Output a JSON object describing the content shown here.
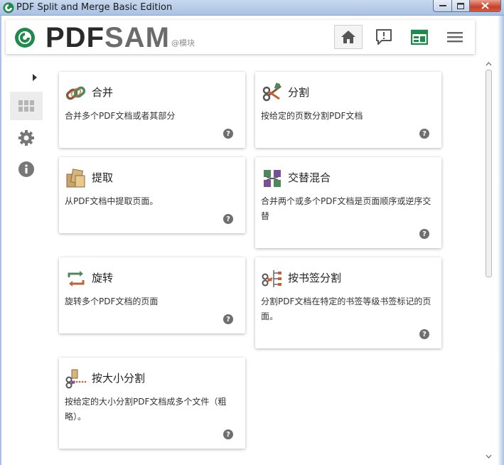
{
  "window": {
    "title": "PDF Split and Merge Basic Edition"
  },
  "header": {
    "logo_pdf": "PDF",
    "logo_sam": "SAM",
    "logo_sub": "@模块",
    "buttons": [
      "home-icon",
      "news-icon",
      "dashboard-icon",
      "menu-icon"
    ]
  },
  "sidebar": {
    "items": [
      {
        "icon": "grid-icon",
        "active": true
      },
      {
        "icon": "gear-icon",
        "active": false
      },
      {
        "icon": "info-icon",
        "active": false
      }
    ]
  },
  "tiles": [
    {
      "title": "合并",
      "desc": "合并多个PDF文档或者其部分",
      "icon": "merge-chain-icon"
    },
    {
      "title": "分割",
      "desc": "按给定的页数分割PDF文档",
      "icon": "split-scissors-icon"
    },
    {
      "title": "提取",
      "desc": "从PDF文档中提取页面。",
      "icon": "extract-pages-icon"
    },
    {
      "title": "交替混合",
      "desc": "合并两个或多个PDF文档是页面顺序或逆序交替",
      "icon": "alternate-mix-icon"
    },
    {
      "title": "旋转",
      "desc": "旋转多个PDF文档的页面",
      "icon": "rotate-icon"
    },
    {
      "title": "按书签分割",
      "desc": "分割PDF文档在特定的书签等级书签标记的页面。",
      "icon": "bookmark-split-icon"
    },
    {
      "title": "按大小分割",
      "desc": "按给定的大小分割PDF文档成多个文件（粗略）。",
      "icon": "size-split-icon"
    }
  ],
  "help_glyph": "?",
  "colors": {
    "accent_green": "#1f8a4c",
    "logo_dark": "#2a2a2a",
    "logo_grey": "#6b6b6b"
  }
}
